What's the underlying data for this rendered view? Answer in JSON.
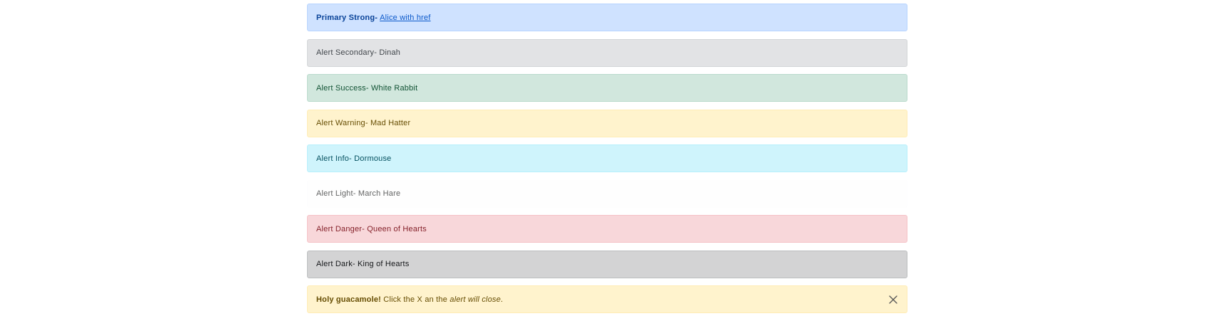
{
  "alerts": {
    "primary": {
      "strong": "Primary Strong-",
      "link": "Alice with href"
    },
    "secondary": "Alert Secondary- Dinah",
    "success": "Alert Success- White Rabbit",
    "warning": "Alert Warning- Mad Hatter",
    "info": "Alert Info- Dormouse",
    "light": "Alert Light- March Hare",
    "danger": "Alert Danger- Queen of Hearts",
    "dark": "Alert Dark- King of Hearts",
    "dismissible": {
      "strong": "Holy guacamole!",
      "text_before": "Click the X an the",
      "emphasis": "alert will close",
      "text_after": ".",
      "close_icon": "close-icon"
    }
  },
  "colors": {
    "primary_bg": "#cfe2ff",
    "secondary_bg": "#e2e3e5",
    "success_bg": "#d1e7dd",
    "warning_bg": "#fff3cd",
    "info_bg": "#cff4fc",
    "light_bg": "#fefefe",
    "danger_bg": "#f8d7da",
    "dark_bg": "#d3d3d4"
  }
}
